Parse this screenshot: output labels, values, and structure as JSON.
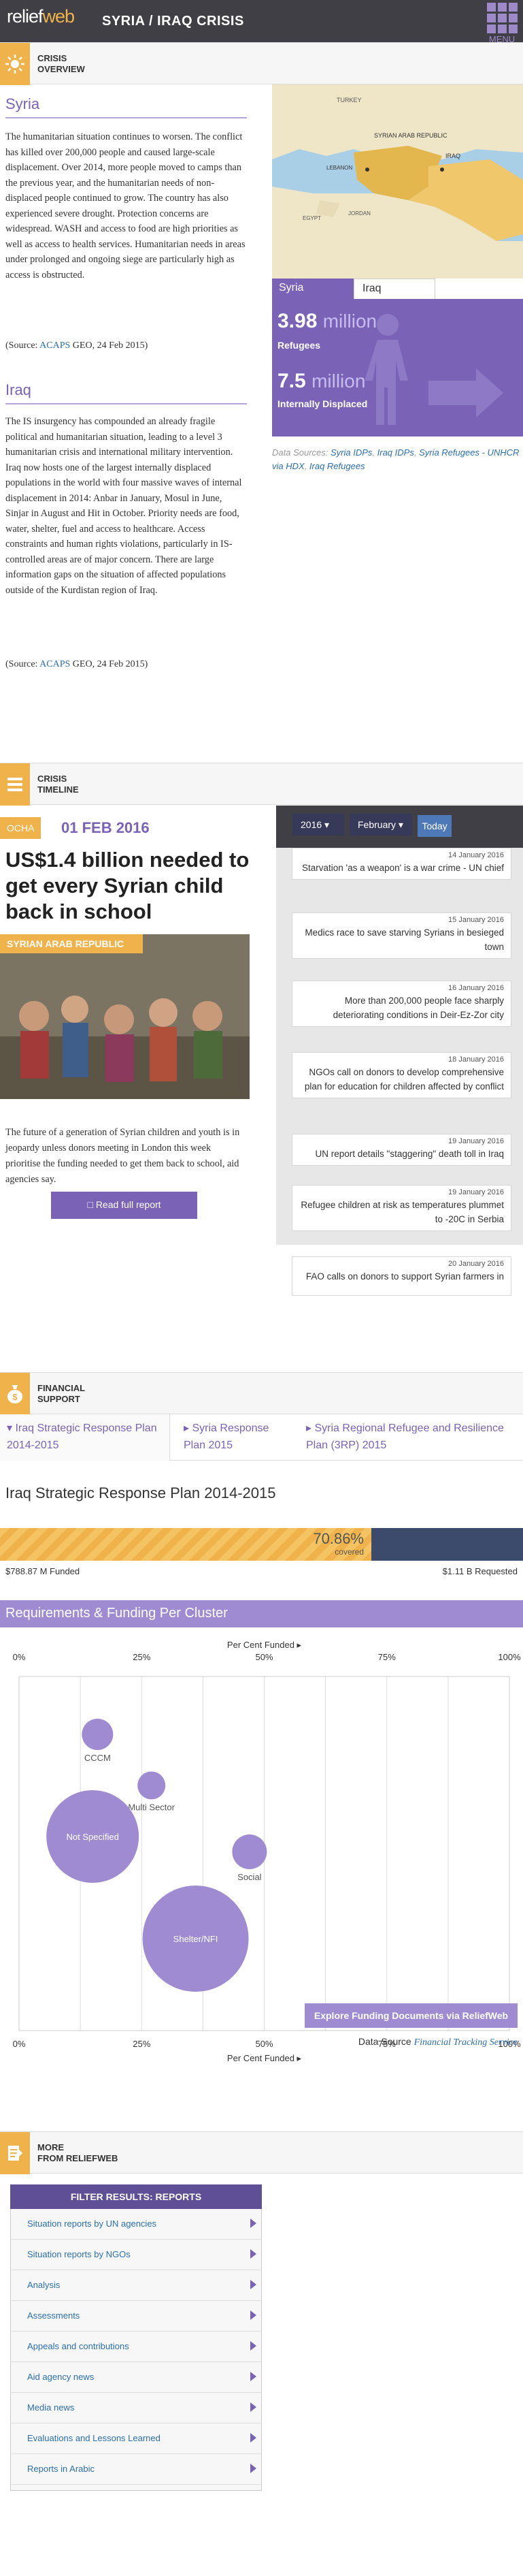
{
  "header": {
    "logo_left": "relief",
    "logo_right": "web",
    "title": "SYRIA / IRAQ CRISIS",
    "menu_label": "MENU"
  },
  "overview": {
    "section_title_1": "CRISIS",
    "section_title_2": "OVERVIEW",
    "syria": {
      "heading": "Syria",
      "text": "The humanitarian situation continues to worsen. The conflict has killed over 200,000 people and caused large-scale displacement. Over 2014, more people moved to camps than the previous year, and the humanitarian needs of non-displaced people continued to grow. The country has also experienced severe drought. Protection concerns are widespread. WASH and access to food are high priorities as well as access to health services. Humanitarian needs in areas under prolonged and ongoing siege are particularly high as access is obstructed.",
      "source_prefix": "(Source: ",
      "source_link": "ACAPS",
      "source_suffix": " GEO, 24 Feb 2015)"
    },
    "iraq": {
      "heading": "Iraq",
      "text": "The IS insurgency has compounded an already fragile political and humanitarian situation, leading to a level 3 humanitarian crisis and international military intervention. Iraq now hosts one of the largest internally displaced populations in the world with four massive waves of internal displacement in 2014: Anbar in January, Mosul in June, Sinjar in August and Hit in October. Priority needs are food, water, shelter, fuel and access to healthcare. Access constraints and human rights violations, particularly in IS-controlled areas are of major concern. There are large information gaps on the situation of affected populations outside of the Kurdistan region of Iraq.",
      "source_prefix": "(Source: ",
      "source_link": "ACAPS",
      "source_suffix": " GEO, 24 Feb 2015)"
    },
    "map_labels": {
      "turkey": "TURKEY",
      "syria": "SYRIAN ARAB REPUBLIC",
      "lebanon": "LEBANON",
      "iraq": "IRAQ",
      "egypt": "EGYPT",
      "jordan": "JORDAN"
    },
    "tabs": [
      "Syria",
      "Iraq"
    ],
    "stats": {
      "refugees_num": "3.98",
      "refugees_unit": "million",
      "refugees_label": "Refugees",
      "idp_num": "7.5",
      "idp_unit": "million",
      "idp_label": "Internally Displaced"
    },
    "data_sources": {
      "label": "Data Sources: ",
      "links": [
        "Syria IDPs",
        "Iraq IDPs",
        "Syria Refugees - UNHCR via HDX",
        "Iraq Refugees"
      ]
    }
  },
  "timeline": {
    "section_title_1": "CRISIS",
    "section_title_2": "TIMELINE",
    "source_tag": "OCHA",
    "date": "01 FEB 2016",
    "headline": "US$1.4 billion needed to get every Syrian child back in school",
    "image_tag": "SYRIAN ARAB REPUBLIC",
    "body": "The future of a generation of Syrian children and youth is in jeopardy unless donors meeting in London this week prioritise the funding needed to get them back to school, aid agencies say.",
    "read_button": "Read full report",
    "year": "2016",
    "month": "February",
    "today": "Today",
    "news": [
      {
        "date": "14 January 2016",
        "title": "Starvation 'as a weapon' is a war crime - UN chief"
      },
      {
        "date": "15 January 2016",
        "title": "Medics race to save starving Syrians in besieged town"
      },
      {
        "date": "16 January 2016",
        "title": "More than 200,000 people face sharply deteriorating conditions in Deir-Ez-Zor city"
      },
      {
        "date": "18 January 2016",
        "title": "NGOs call on donors to develop comprehensive plan for education for children affected by conflict"
      },
      {
        "date": "19 January 2016",
        "title": "UN report details \"staggering\" death toll in Iraq"
      },
      {
        "date": "19 January 2016",
        "title": "Refugee children at risk as temperatures plummet to -20C in Serbia"
      },
      {
        "date": "20 January 2016",
        "title": "FAO calls on donors to support Syrian farmers in"
      }
    ]
  },
  "financial": {
    "section_title_1": "FINANCIAL",
    "section_title_2": "SUPPORT",
    "tabs": [
      "Iraq Strategic Response Plan 2014-2015",
      "Syria Response Plan 2015",
      "Syria Regional Refugee and Resilience Plan (3RP) 2015"
    ],
    "plan_title": "Iraq Strategic Response Plan 2014-2015",
    "covered_fraction": 0.7086,
    "covered_pct": "70.86%",
    "covered_label": "covered",
    "funded": "$788.87 M Funded",
    "requested": "$1.11 B Requested",
    "req_heading": "Requirements & Funding Per Cluster",
    "explore": "Explore Funding Documents via ReliefWeb",
    "ds_label": "Data Source ",
    "ds_link": "Financial Tracking Service"
  },
  "chart_data": {
    "type": "scatter",
    "title": "",
    "xlabel": "Per Cent Funded",
    "xlim": [
      0,
      100
    ],
    "x_ticks": [
      "0%",
      "25%",
      "50%",
      "75%",
      "100%"
    ],
    "series": [
      {
        "name": "CCCM",
        "x": 16,
        "y_rank": 1,
        "size": 0.6
      },
      {
        "name": "Multi Sector",
        "x": 27,
        "y_rank": 2,
        "size": 0.5
      },
      {
        "name": "Not Specified",
        "x": 15,
        "y_rank": 3,
        "size": 2.4
      },
      {
        "name": "Social",
        "x": 47,
        "y_rank": 3.3,
        "size": 0.7
      },
      {
        "name": "Shelter/NFI",
        "x": 36,
        "y_rank": 5,
        "size": 2.8
      }
    ]
  },
  "more": {
    "section_title_1": "MORE",
    "section_title_2": "FROM RELIEFWEB",
    "filter_head": "FILTER RESULTS: REPORTS",
    "items": [
      "Situation reports by UN agencies",
      "Situation reports by NGOs",
      "Analysis",
      "Assessments",
      "Appeals and contributions",
      "Aid agency news",
      "Media news",
      "Evaluations and Lessons Learned",
      "Reports in Arabic"
    ]
  },
  "colors": {
    "accent": "#7a63b6",
    "gold": "#f0b24a",
    "dark": "#3f3f45"
  }
}
